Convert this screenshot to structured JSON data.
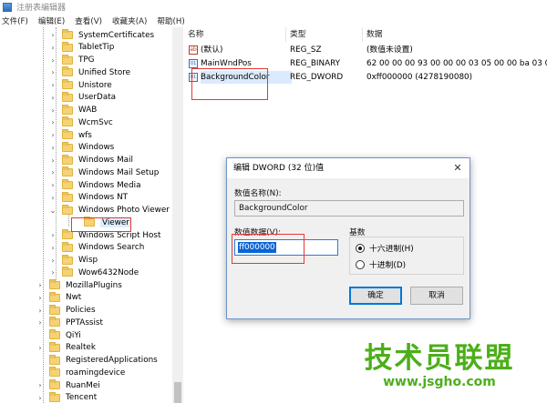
{
  "window": {
    "title": "注册表编辑器"
  },
  "menu": [
    "文件(F)",
    "编辑(E)",
    "查看(V)",
    "收藏夹(A)",
    "帮助(H)"
  ],
  "tree": [
    {
      "label": "SystemCertificates",
      "expander": "›"
    },
    {
      "label": "TabletTip",
      "expander": "›"
    },
    {
      "label": "TPG",
      "expander": "›"
    },
    {
      "label": "Unified Store",
      "expander": "›"
    },
    {
      "label": "Unistore",
      "expander": "›"
    },
    {
      "label": "UserData",
      "expander": "›"
    },
    {
      "label": "WAB",
      "expander": "›"
    },
    {
      "label": "WcmSvc",
      "expander": "›"
    },
    {
      "label": "wfs",
      "expander": "›"
    },
    {
      "label": "Windows",
      "expander": "›"
    },
    {
      "label": "Windows Mail",
      "expander": "›"
    },
    {
      "label": "Windows Mail Setup",
      "expander": "›"
    },
    {
      "label": "Windows Media",
      "expander": "›"
    },
    {
      "label": "Windows NT",
      "expander": "›"
    },
    {
      "label": "Windows Photo Viewer",
      "expander": "⌄"
    },
    {
      "label": "Viewer",
      "expander": ""
    },
    {
      "label": "Windows Script Host",
      "expander": "›"
    },
    {
      "label": "Windows Search",
      "expander": "›"
    },
    {
      "label": "Wisp",
      "expander": "›"
    },
    {
      "label": "Wow6432Node",
      "expander": "›"
    },
    {
      "label": "MozillaPlugins",
      "expander": "›"
    },
    {
      "label": "Nwt",
      "expander": "›"
    },
    {
      "label": "Policies",
      "expander": "›"
    },
    {
      "label": "PPTAssist",
      "expander": "›"
    },
    {
      "label": "QiYi",
      "expander": ""
    },
    {
      "label": "Realtek",
      "expander": "›"
    },
    {
      "label": "RegisteredApplications",
      "expander": ""
    },
    {
      "label": "roamingdevice",
      "expander": ""
    },
    {
      "label": "RuanMei",
      "expander": "›"
    },
    {
      "label": "Tencent",
      "expander": "›"
    }
  ],
  "list": {
    "columns": [
      "名称",
      "类型",
      "数据"
    ],
    "rows": [
      {
        "icon": "ab",
        "name": "(默认)",
        "type": "REG_SZ",
        "data": "(数值未设置)"
      },
      {
        "icon": "01",
        "name": "MainWndPos",
        "type": "REG_BINARY",
        "data": "62 00 00 00 93 00 00 00 03 05 00 00 ba 03 0..."
      },
      {
        "icon": "01",
        "name": "BackgroundColor",
        "type": "REG_DWORD",
        "data": "0xff000000 (4278190080)"
      }
    ]
  },
  "dialog": {
    "title": "编辑 DWORD (32 位)值",
    "close": "✕",
    "name_label": "数值名称(N):",
    "name_value": "BackgroundColor",
    "data_label": "数值数据(V):",
    "data_value": "ff000000",
    "base_label": "基数",
    "hex_label": "十六进制(H)",
    "dec_label": "十进制(D)",
    "ok_label": "确定",
    "cancel_label": "取消"
  },
  "watermark": {
    "main": "技术员联盟",
    "url": "www.jsgho.com"
  },
  "colors": {
    "accent": "#0078d7",
    "highlight": "#e53935",
    "folder": "#f6d275",
    "watermark": "#4caf1a"
  }
}
